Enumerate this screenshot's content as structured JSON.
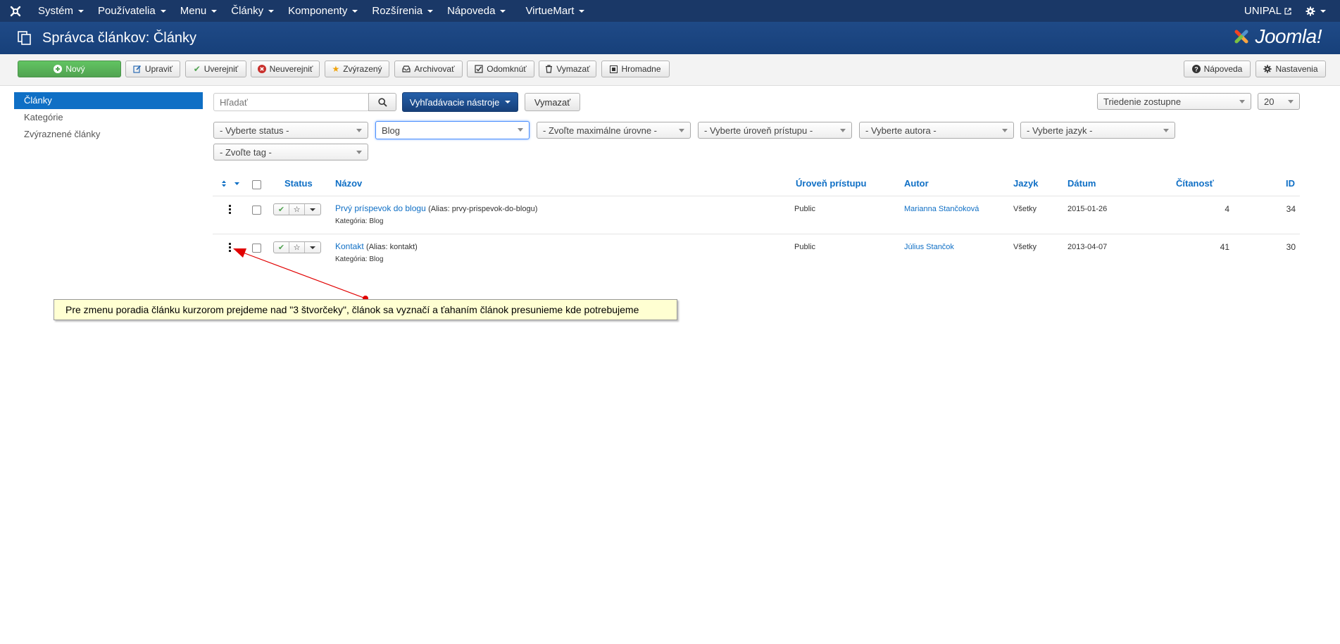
{
  "navbar": {
    "items": [
      {
        "label": "Systém"
      },
      {
        "label": "Používatelia"
      },
      {
        "label": "Menu"
      },
      {
        "label": "Články"
      },
      {
        "label": "Komponenty"
      },
      {
        "label": "Rozšírenia"
      },
      {
        "label": "Nápoveda"
      },
      {
        "label": "VirtueMart"
      }
    ],
    "site_label": "UNIPAL"
  },
  "header": {
    "title": "Správca článkov: Články",
    "brand": "Joomla!"
  },
  "toolbar": {
    "new_label": "Nový",
    "edit_label": "Upraviť",
    "publish_label": "Uverejniť",
    "unpublish_label": "Neuverejniť",
    "featured_label": "Zvýrazený",
    "archive_label": "Archivovať",
    "checkin_label": "Odomknúť",
    "trash_label": "Vymazať",
    "batch_label": "Hromadne",
    "help_label": "Nápoveda",
    "options_label": "Nastavenia"
  },
  "sidebar": {
    "items": [
      {
        "label": "Články",
        "active": true
      },
      {
        "label": "Kategórie"
      },
      {
        "label": "Zvýraznené články"
      }
    ]
  },
  "filters": {
    "search_placeholder": "Hľadať",
    "search_tools_label": "Vyhľadávacie nástroje",
    "clear_label": "Vymazať",
    "ordering": "Triedenie zostupne",
    "limit": "20",
    "status": "- Vyberte status -",
    "category": "Blog",
    "max_levels": "- Zvoľte maximálne úrovne -",
    "access": "- Vyberte úroveň prístupu -",
    "author": "- Vyberte autora -",
    "language": "- Vyberte jazyk -",
    "tag": "- Zvoľte tag -"
  },
  "table": {
    "headers": {
      "status": "Status",
      "title": "Názov",
      "access": "Úroveň prístupu",
      "author": "Autor",
      "language": "Jazyk",
      "date": "Dátum",
      "hits": "Čítanosť",
      "id": "ID"
    },
    "rows": [
      {
        "title": "Prvý príspevok do blogu",
        "alias": "(Alias: prvy-prispevok-do-blogu)",
        "category": "Kategória: Blog",
        "access": "Public",
        "author": "Marianna Stančoková",
        "language": "Všetky",
        "date": "2015-01-26",
        "hits": "4",
        "id": "34"
      },
      {
        "title": "Kontakt",
        "alias": "(Alias: kontakt)",
        "category": "Kategória: Blog",
        "access": "Public",
        "author": "Július Stančok",
        "language": "Všetky",
        "date": "2013-04-07",
        "hits": "41",
        "id": "30"
      }
    ]
  },
  "callout": {
    "text": "Pre zmenu poradia článku kurzorom prejdeme nad \"3 štvorčeky\", článok sa vyznačí a ťahaním článok presunieme kde potrebujeme"
  },
  "colors": {
    "navbar": "#1a3867",
    "header": "#1f4a87",
    "link": "#0f6fc5",
    "success": "#51a351",
    "annotation": "#e10000",
    "callout_bg": "#ffffd2"
  }
}
